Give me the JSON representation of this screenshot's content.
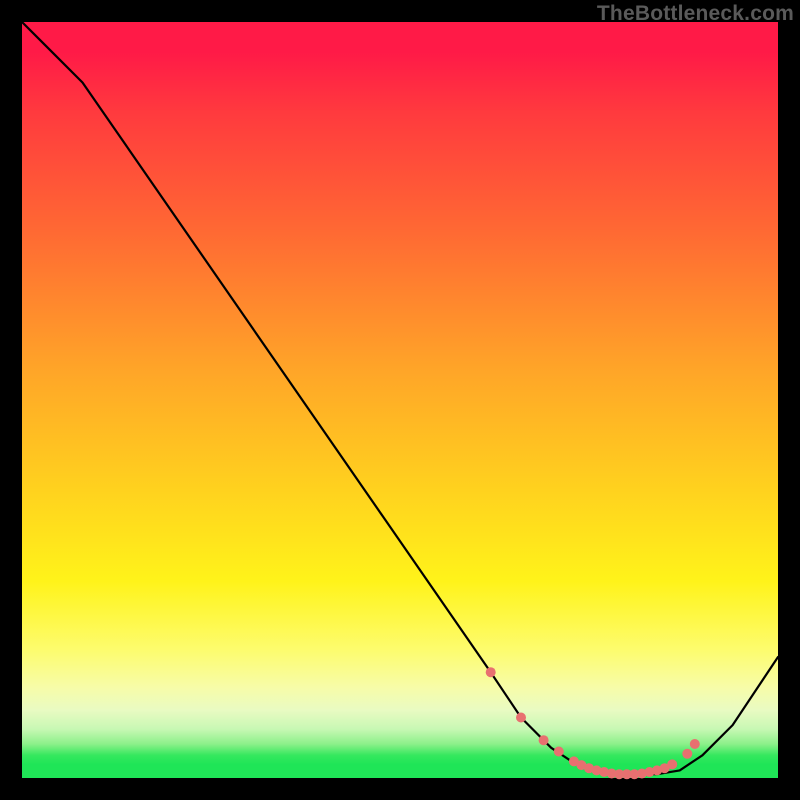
{
  "watermark": "TheBottleneck.com",
  "colors": {
    "background": "#000000",
    "curve": "#000000",
    "marker": "#e87070",
    "gradient_top": "#ff1a47",
    "gradient_bottom": "#1fe557"
  },
  "chart_data": {
    "type": "line",
    "title": "",
    "xlabel": "",
    "ylabel": "",
    "xlim": [
      0,
      100
    ],
    "ylim": [
      0,
      100
    ],
    "grid": false,
    "legend": false,
    "annotations": [
      "TheBottleneck.com"
    ],
    "series": [
      {
        "name": "curve",
        "x": [
          0,
          3,
          8,
          62,
          66,
          70,
          73,
          76,
          79,
          81,
          84,
          87,
          90,
          94,
          100
        ],
        "values": [
          100,
          97,
          92,
          14,
          8,
          4,
          2,
          1,
          0.5,
          0.5,
          0.5,
          1,
          3,
          7,
          16
        ]
      }
    ],
    "markers": {
      "name": "highlight-points",
      "color": "#e87070",
      "x": [
        62,
        66,
        69,
        71,
        73,
        74,
        75,
        76,
        77,
        78,
        79,
        80,
        81,
        82,
        83,
        84,
        85,
        86,
        88,
        89
      ],
      "values": [
        14,
        8,
        5,
        3.5,
        2.2,
        1.7,
        1.3,
        1.0,
        0.8,
        0.6,
        0.5,
        0.5,
        0.5,
        0.6,
        0.8,
        1.0,
        1.3,
        1.8,
        3.2,
        4.5
      ]
    }
  }
}
